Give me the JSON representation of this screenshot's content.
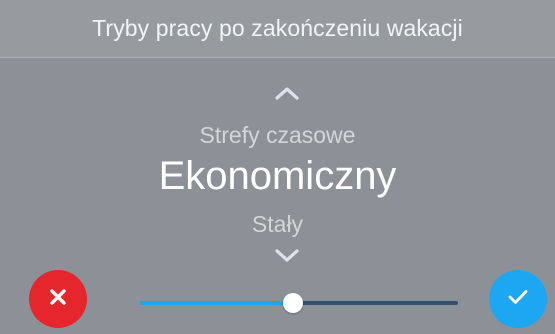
{
  "header": {
    "title": "Tryby pracy po zakończeniu wakacji"
  },
  "picker": {
    "up_icon": "chevron-up-icon",
    "down_icon": "chevron-down-icon",
    "previous_option": "Strefy czasowe",
    "selected_option": "Ekonomiczny",
    "next_option": "Stały"
  },
  "footer": {
    "cancel_icon": "close-icon",
    "confirm_icon": "check-icon",
    "slider_level": 0.48
  },
  "colors": {
    "panel_background": "#8c9197",
    "header_background": "#969ba0",
    "cancel": "#e5262d",
    "confirm": "#1da6f1",
    "slider_fill": "#1da6f1",
    "slider_track": "#34506f"
  }
}
